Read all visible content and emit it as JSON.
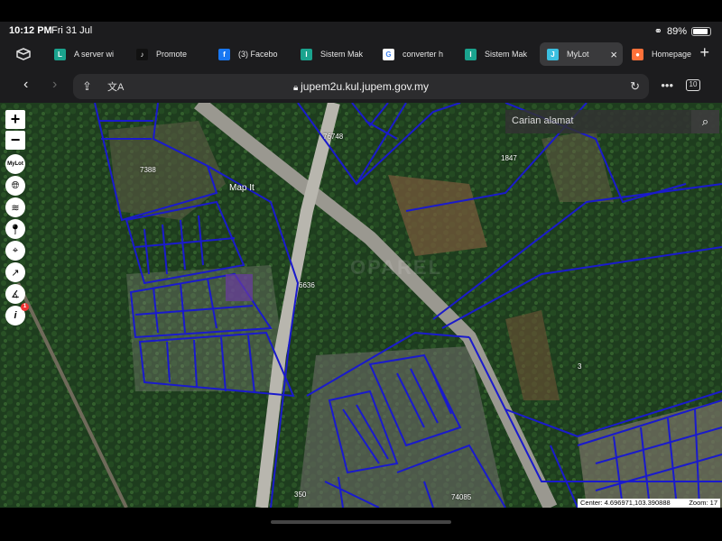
{
  "status": {
    "time": "10:12 PM",
    "date": "Fri 31 Jul",
    "battery": "89%",
    "battery_level": 0.89
  },
  "tabs": [
    {
      "label": "A server wi",
      "icon": "letter-l-icon",
      "favicon_text": "L",
      "color": "#1aa38e"
    },
    {
      "label": "Promote",
      "icon": "tiktok-icon",
      "favicon_text": "♪",
      "color": "#111111"
    },
    {
      "label": "(3) Facebo",
      "icon": "facebook-icon",
      "favicon_text": "f",
      "color": "#1877f2"
    },
    {
      "label": "Sistem Mak",
      "icon": "letter-i-icon",
      "favicon_text": "I",
      "color": "#1aa38e"
    },
    {
      "label": "converter h",
      "icon": "google-icon",
      "favicon_text": "G",
      "color": "#ffffff"
    },
    {
      "label": "Sistem Mak",
      "icon": "letter-i-icon",
      "favicon_text": "I",
      "color": "#1aa38e"
    },
    {
      "label": "MyLot",
      "icon": "letter-j-icon",
      "favicon_text": "J",
      "color": "#3bbfe0",
      "active": true
    },
    {
      "label": "Homepage",
      "icon": "firefox-icon",
      "favicon_text": "●",
      "color": "#ff7139"
    }
  ],
  "address": {
    "url": "jupem2u.kul.jupem.gov.my",
    "tab_count": "10"
  },
  "map": {
    "search_placeholder": "Carian alamat",
    "map_it_label": "Map It",
    "watermark": "OPAREL",
    "tool_labels": {
      "mylot": "MyLot",
      "info_badge": "1"
    },
    "coords": {
      "center": "Center: 4.696971,103.390888",
      "zoom": "Zoom: 17"
    },
    "lot_labels": [
      "7388",
      "76748",
      "1847",
      "6636",
      "350",
      "74085",
      "3"
    ],
    "parcel_color": "#1a1acc"
  }
}
